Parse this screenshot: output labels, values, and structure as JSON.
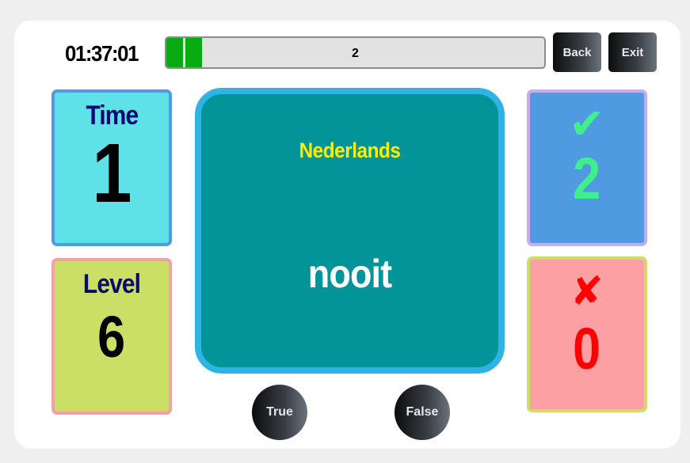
{
  "header": {
    "timer": "01:37:01",
    "progress_label": "2",
    "progress_segments": 2,
    "back_label": "Back",
    "exit_label": "Exit"
  },
  "time_panel": {
    "title": "Time",
    "value": "1"
  },
  "level_panel": {
    "title": "Level",
    "value": "6"
  },
  "card": {
    "language": "Nederlands",
    "word": "nooit"
  },
  "correct_panel": {
    "icon": "check-icon",
    "symbol": "✔",
    "value": "2"
  },
  "wrong_panel": {
    "icon": "cross-icon",
    "symbol": "✘",
    "value": "0"
  },
  "answers": {
    "true_label": "True",
    "false_label": "False"
  },
  "colors": {
    "time_bg": "#5ee2e8",
    "time_border": "#4f9ae0",
    "level_bg": "#cbde66",
    "level_border": "#f4a0a4",
    "correct_bg": "#4f9ae0",
    "correct_border": "#c8aaf0",
    "correct_fg": "#3ff08a",
    "wrong_bg": "#fca0a4",
    "wrong_border": "#cbde66",
    "wrong_fg": "#ff0000",
    "card_bg": "#039499",
    "card_border": "#2fb3e2",
    "progress_fill": "#0aaa12"
  }
}
